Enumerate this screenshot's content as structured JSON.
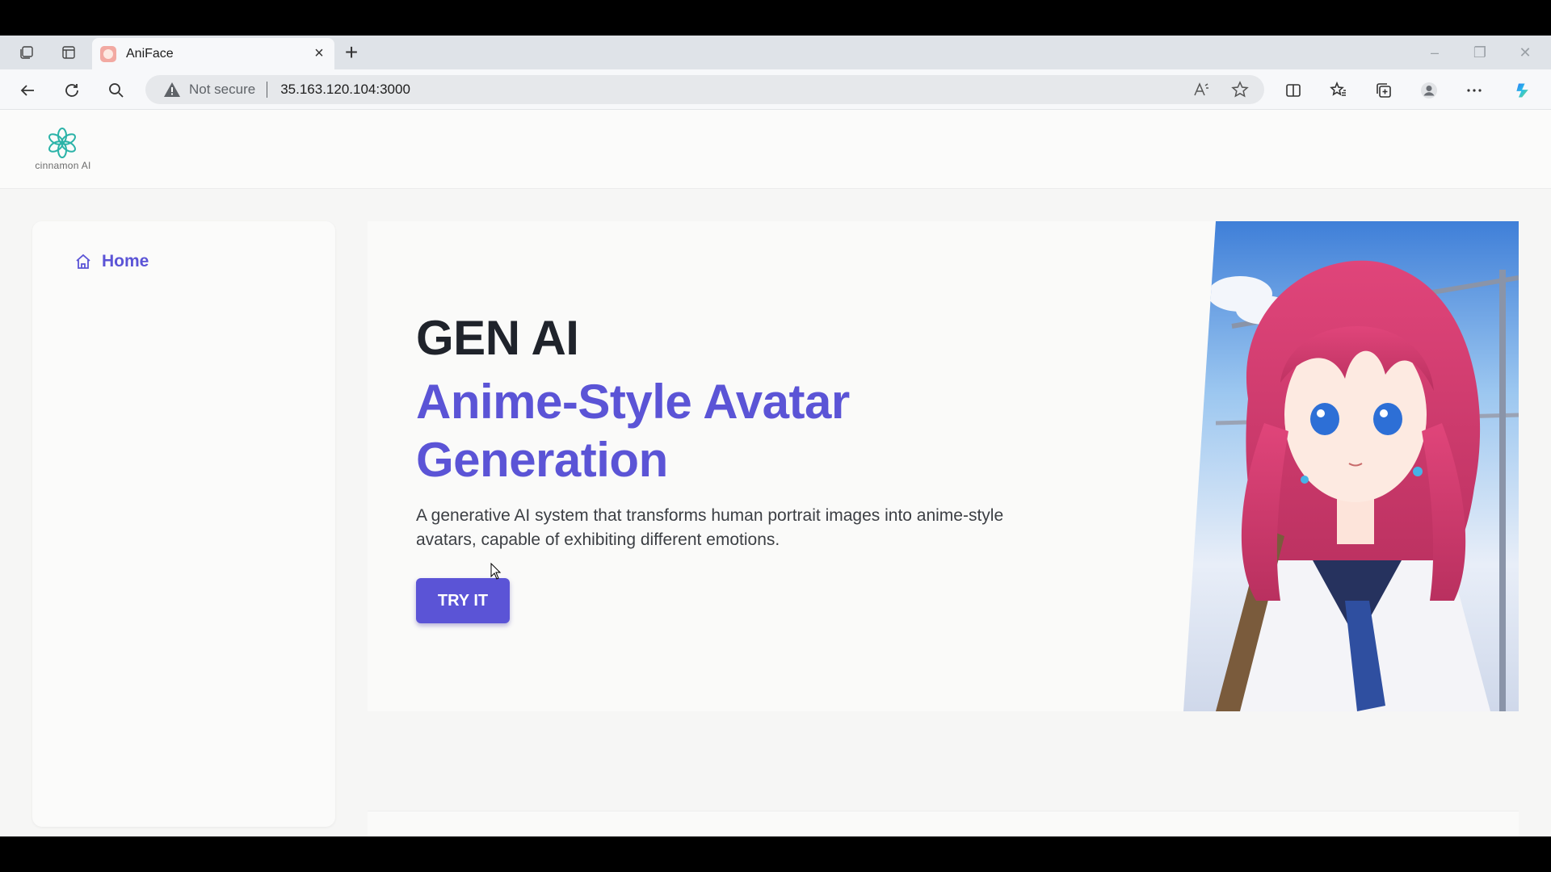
{
  "browser": {
    "tab_title": "AniFace",
    "security_label": "Not secure",
    "url": "35.163.120.104:3000"
  },
  "header": {
    "logo_text": "cinnamon AI"
  },
  "sidebar": {
    "items": [
      {
        "label": "Home",
        "icon": "home-icon"
      }
    ]
  },
  "hero": {
    "eyebrow": "GEN AI",
    "title": "Anime-Style Avatar Generation",
    "description": "A generative AI system that transforms human portrait images into anime-style avatars, capable of exhibiting different emotions.",
    "cta_label": "TRY IT",
    "image_alt": "anime-girl-illustration"
  },
  "colors": {
    "accent": "#5b54d6",
    "heading": "#1f232b",
    "logo_teal": "#2bb3a8"
  }
}
